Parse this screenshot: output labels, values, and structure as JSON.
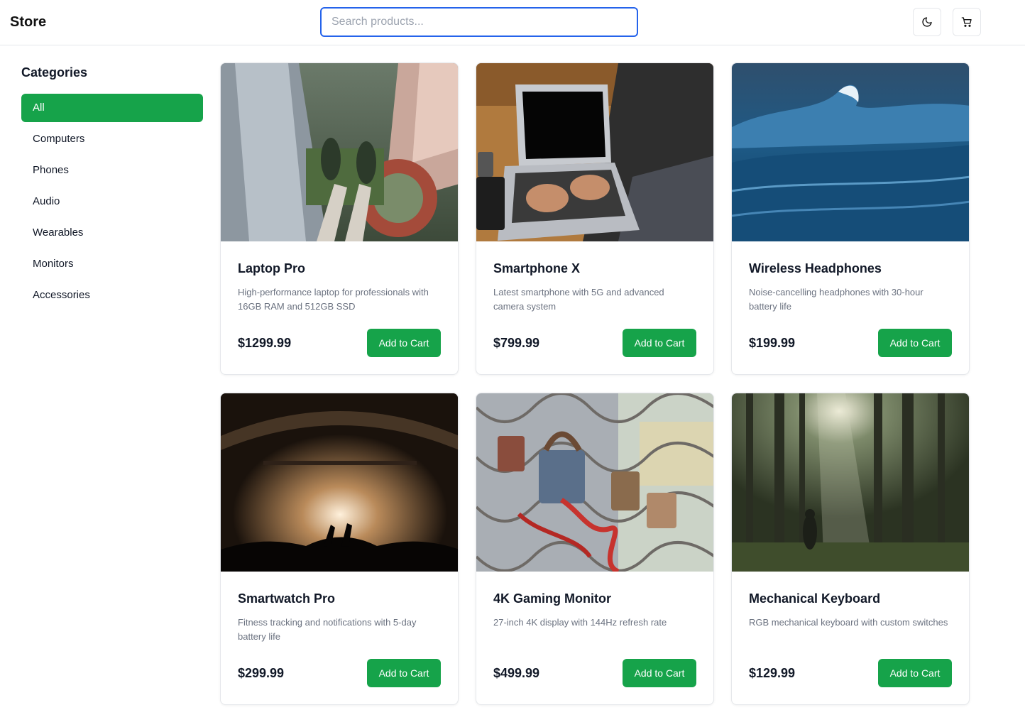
{
  "header": {
    "brand": "Store",
    "search_placeholder": "Search products...",
    "theme_icon": "moon-icon",
    "cart_icon": "cart-icon"
  },
  "sidebar": {
    "title": "Categories",
    "items": [
      {
        "label": "All",
        "active": true
      },
      {
        "label": "Computers",
        "active": false
      },
      {
        "label": "Phones",
        "active": false
      },
      {
        "label": "Audio",
        "active": false
      },
      {
        "label": "Wearables",
        "active": false
      },
      {
        "label": "Monitors",
        "active": false
      },
      {
        "label": "Accessories",
        "active": false
      }
    ]
  },
  "products": [
    {
      "name": "Laptop Pro",
      "description": "High-performance laptop for professionals with 16GB RAM and 512GB SSD",
      "price": "$1299.99",
      "button": "Add to Cart"
    },
    {
      "name": "Smartphone X",
      "description": "Latest smartphone with 5G and advanced camera system",
      "price": "$799.99",
      "button": "Add to Cart"
    },
    {
      "name": "Wireless Headphones",
      "description": "Noise-cancelling headphones with 30-hour battery life",
      "price": "$199.99",
      "button": "Add to Cart"
    },
    {
      "name": "Smartwatch Pro",
      "description": "Fitness tracking and notifications with 5-day battery life",
      "price": "$299.99",
      "button": "Add to Cart"
    },
    {
      "name": "4K Gaming Monitor",
      "description": "27-inch 4K display with 144Hz refresh rate",
      "price": "$499.99",
      "button": "Add to Cart"
    },
    {
      "name": "Mechanical Keyboard",
      "description": "RGB mechanical keyboard with custom switches",
      "price": "$129.99",
      "button": "Add to Cart"
    }
  ],
  "colors": {
    "accent": "#16a34a",
    "focus": "#2563eb"
  }
}
